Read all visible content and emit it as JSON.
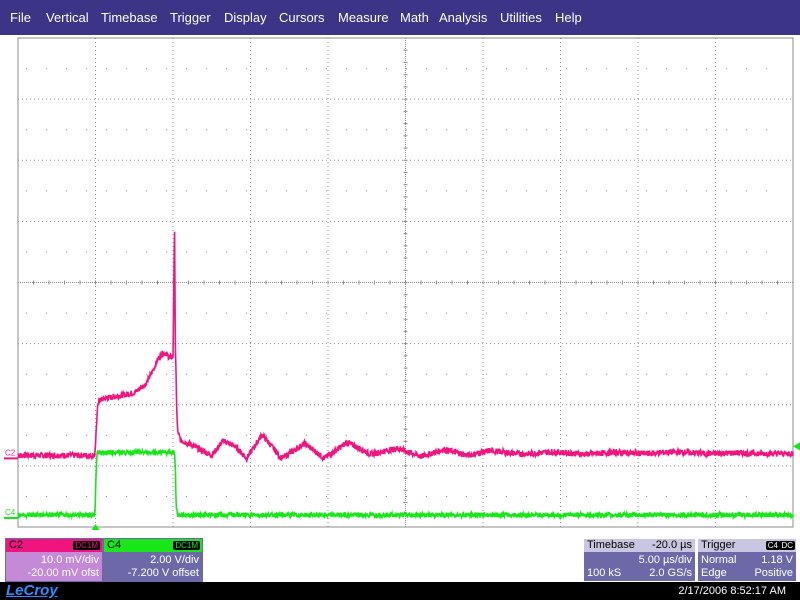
{
  "menu": [
    "File",
    "Vertical",
    "Timebase",
    "Trigger",
    "Display",
    "Cursors",
    "Measure",
    "Math",
    "Analysis",
    "Utilities",
    "Help"
  ],
  "colors": {
    "menubar": "#3c3486",
    "ch2": "#f0147e",
    "ch4": "#19e619",
    "grid": "#8c8c8c",
    "panel": "#6d69a8",
    "ch2_panel": "#c48ad8"
  },
  "channels": {
    "c2": {
      "marker": "C2",
      "label": "C2",
      "coupling": "DC1M",
      "vdiv": "10.0 mV/div",
      "offset": "-20.00 mV ofst"
    },
    "c4": {
      "marker": "C4",
      "label": "C4",
      "coupling": "DC1M",
      "vdiv": "2.00 V/div",
      "offset": "-7.200 V offset"
    }
  },
  "timebase": {
    "label": "Timebase",
    "delay": "-20.0 µs",
    "tdiv": "5.00 µs/div",
    "samples": "100 kS",
    "rate": "2.0 GS/s"
  },
  "trigger": {
    "label": "Trigger",
    "source": "C4",
    "coupling": "DC",
    "mode": "Normal",
    "level": "1.18 V",
    "type": "Edge",
    "slope": "Positive"
  },
  "status": {
    "brand": "LeCroy",
    "datetime": "2/17/2006 8:52:17 AM"
  },
  "chart_data": {
    "type": "line",
    "x_divisions": 10,
    "y_divisions": 8,
    "grid": true,
    "series": [
      {
        "name": "C2",
        "x": [
          0.0,
          0.99,
          1.01,
          1.03,
          1.1,
          1.3,
          1.5,
          1.65,
          1.75,
          1.8,
          1.85,
          1.9,
          1.95,
          2.0,
          2.02,
          2.03,
          2.04,
          2.05,
          2.06,
          2.1,
          2.2,
          2.35,
          2.5,
          2.65,
          2.8,
          2.95,
          3.15,
          3.4,
          3.7,
          3.95,
          4.25,
          4.55,
          4.9,
          5.2,
          5.5,
          5.8,
          6.1,
          6.5,
          6.9,
          7.3,
          7.7,
          8.1,
          8.5,
          8.9,
          9.3,
          9.7,
          10.0
        ],
        "y": [
          1.0,
          1.0,
          1.4,
          1.9,
          1.95,
          2.0,
          2.05,
          2.2,
          2.45,
          2.6,
          2.7,
          2.72,
          2.65,
          2.66,
          4.8,
          2.8,
          2.3,
          1.7,
          1.4,
          1.25,
          1.2,
          1.1,
          1.0,
          1.25,
          1.15,
          0.95,
          1.35,
          0.95,
          1.2,
          0.95,
          1.22,
          1.02,
          1.12,
          0.98,
          1.1,
          1.0,
          1.08,
          1.02,
          1.06,
          1.02,
          1.05,
          1.03,
          1.06,
          1.03,
          1.04,
          1.03,
          1.03
        ]
      },
      {
        "name": "C4",
        "x": [
          0.0,
          0.99,
          1.0,
          1.01,
          1.02,
          2.02,
          2.03,
          2.04,
          2.06,
          10.0
        ],
        "y": [
          0.0,
          0.0,
          0.3,
          0.8,
          1.05,
          1.05,
          0.8,
          0.2,
          0.0,
          0.0
        ]
      }
    ]
  }
}
